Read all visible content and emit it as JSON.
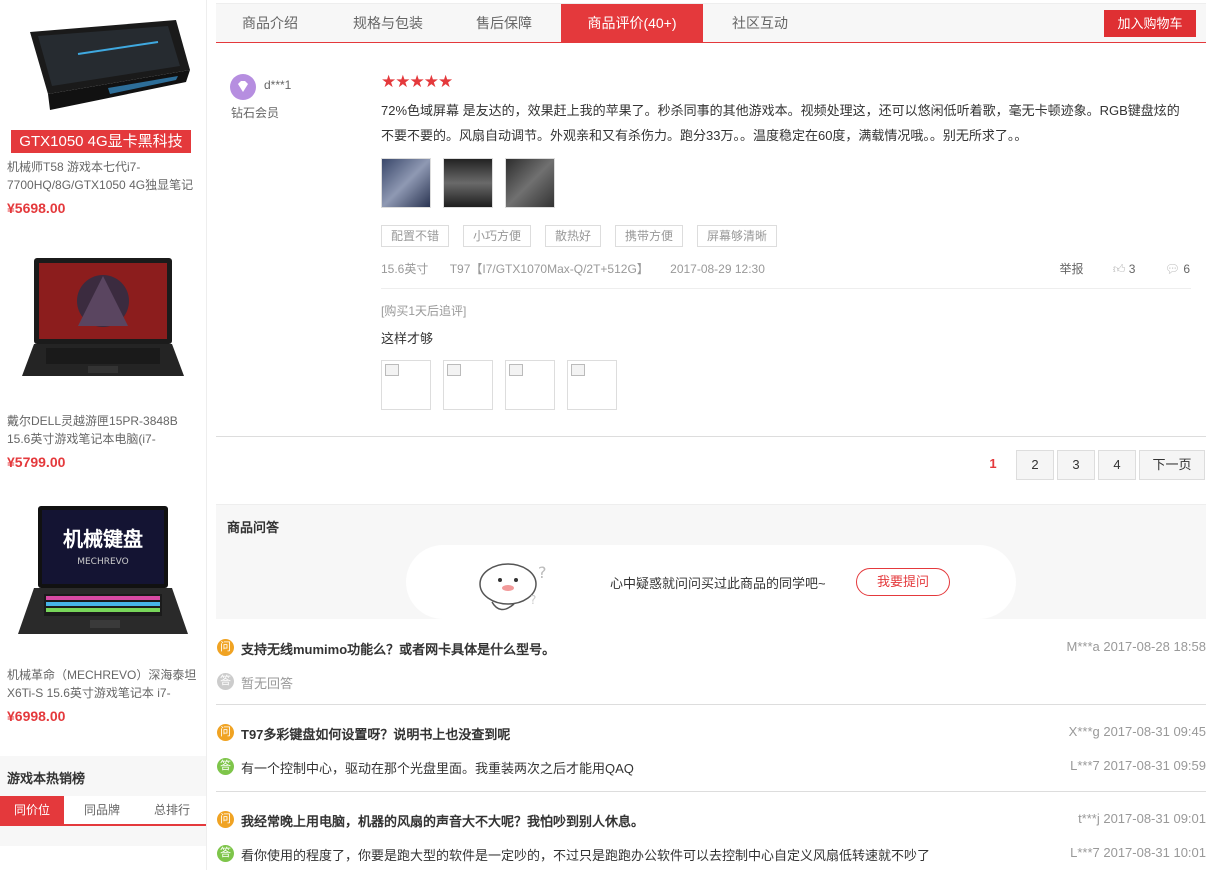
{
  "sidebar": {
    "products": [
      {
        "badge": "GTX1050 4G显卡黑科技",
        "name": "机械师T58 游戏本七代i7-7700HQ/8G/GTX1050 4G独显笔记",
        "price": "¥5698.00"
      },
      {
        "name": "戴尔DELL灵越游匣15PR-3848B 15.6英寸游戏笔记本电脑(i7-",
        "price": "¥5799.00"
      },
      {
        "name": "机械革命（MECHREVO）深海泰坦X6Ti-S 15.6英寸游戏笔记本 i7-",
        "price": "¥6998.00",
        "screen_text": "机械键盘",
        "screen_sub": "MECHREVO"
      }
    ],
    "ranking": {
      "title": "游戏本热销榜",
      "tabs": [
        "同价位",
        "同品牌",
        "总排行"
      ]
    }
  },
  "tabs": [
    "商品介绍",
    "规格与包装",
    "售后保障",
    "商品评价(40+)",
    "社区互动"
  ],
  "cart_button": "加入购物车",
  "review": {
    "user": "d***1",
    "level": "钻石会员",
    "stars": 5,
    "text": "72%色域屏幕 是友达的，效果赶上我的苹果了。秒杀同事的其他游戏本。视频处理这，还可以悠闲低听着歌，毫无卡顿迹象。RGB键盘炫的不要不要的。风扇自动调节。外观亲和又有杀伤力。跑分33万。。温度稳定在60度，满载情况哦。。别无所求了。。",
    "tags": [
      "配置不错",
      "小巧方便",
      "散热好",
      "携带方便",
      "屏幕够清晰"
    ],
    "size": "15.6英寸",
    "config": "T97【I7/GTX1070Max-Q/2T+512G】",
    "date": "2017-08-29 12:30",
    "report": "举报",
    "likes": "3",
    "comments": "6",
    "append_label": "[购买1天后追评]",
    "append_text": "这样才够"
  },
  "pager": {
    "pages": [
      "1",
      "2",
      "3",
      "4"
    ],
    "next": "下一页"
  },
  "qa": {
    "title": "商品问答",
    "ask_prompt": "心中疑惑就问问买过此商品的同学吧~",
    "ask_button": "我要提问",
    "q_icon": "问",
    "a_icon": "答",
    "items": [
      {
        "q": "支持无线mumimo功能么？或者网卡具体是什么型号。",
        "q_meta": "M***a 2017-08-28 18:58",
        "a": "暂无回答",
        "a_meta": ""
      },
      {
        "q": "T97多彩键盘如何设置呀？说明书上也没查到呢",
        "q_meta": "X***g 2017-08-31 09:45",
        "a": "有一个控制中心，驱动在那个光盘里面。我重装两次之后才能用QAQ",
        "a_meta": "L***7 2017-08-31 09:59"
      },
      {
        "q": "我经常晚上用电脑，机器的风扇的声音大不大呢？我怕吵到别人休息。",
        "q_meta": "t***j 2017-08-31 09:01",
        "a": "看你使用的程度了，你要是跑大型的软件是一定吵的，不过只是跑跑办公软件可以去控制中心自定义风扇低转速就不吵了",
        "a_meta": "L***7 2017-08-31 10:01"
      }
    ]
  },
  "colors": {
    "accent": "#e4393c",
    "question": "#f0a323",
    "answer": "#7ec54a"
  }
}
